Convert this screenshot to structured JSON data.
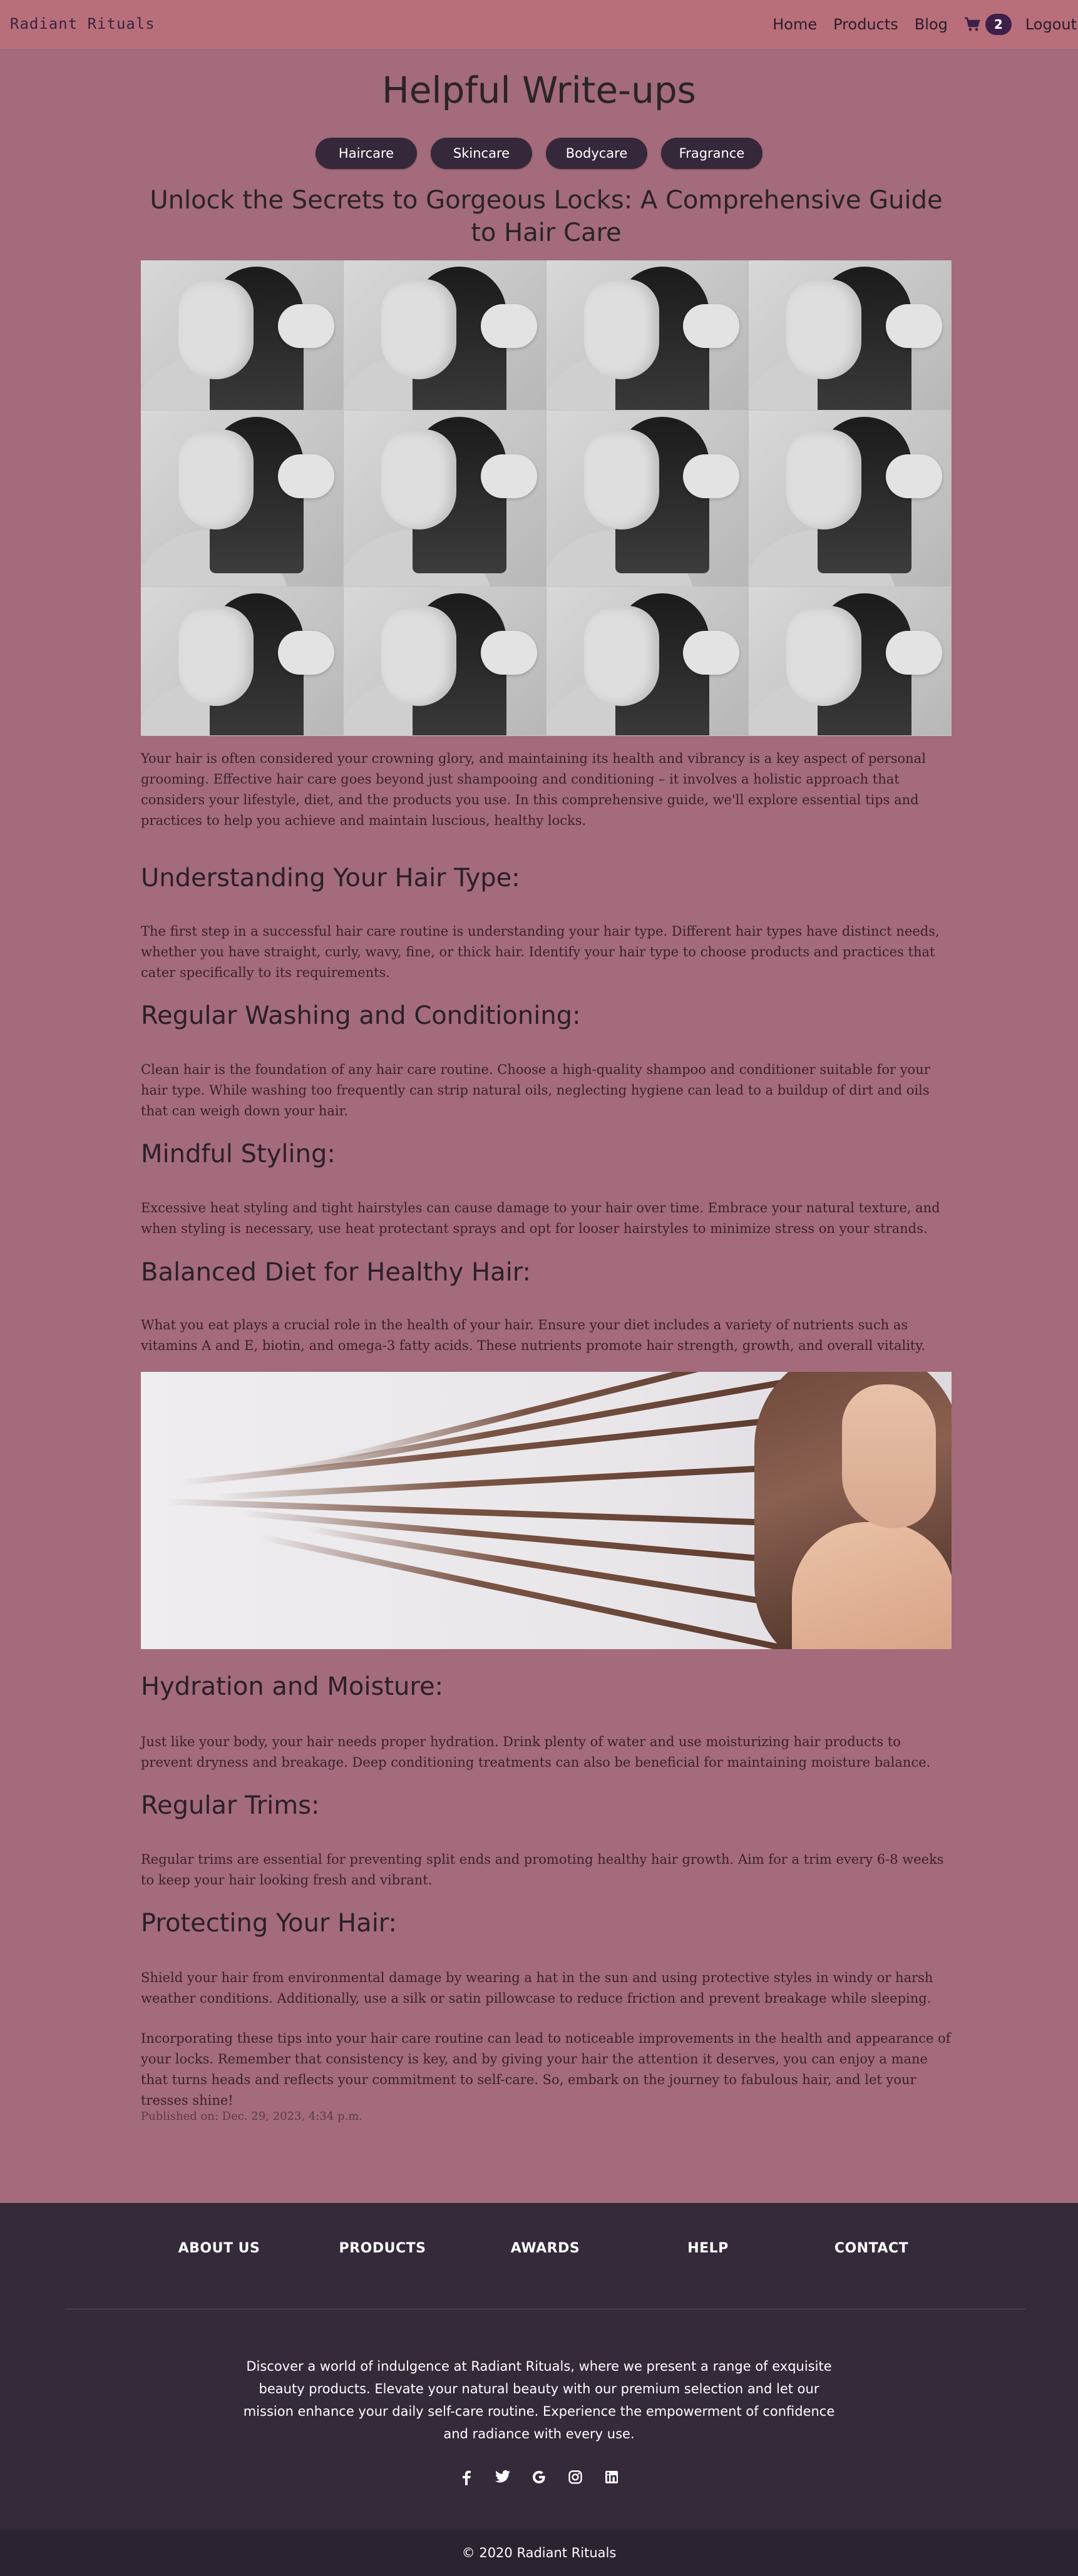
{
  "nav": {
    "brand": "Radiant Rituals",
    "links": [
      "Home",
      "Products",
      "Blog"
    ],
    "cart_count": "2",
    "logout": "Logout"
  },
  "page": {
    "title": "Helpful Write-ups",
    "categories": [
      "Haircare",
      "Skincare",
      "Bodycare",
      "Fragrance"
    ]
  },
  "article": {
    "title": "Unlock the Secrets to Gorgeous Locks: A Comprehensive Guide to Hair Care",
    "intro": "Your hair is often considered your crowning glory, and maintaining its health and vibrancy is a key aspect of personal grooming. Effective hair care goes beyond just shampooing and conditioning – it involves a holistic approach that considers your lifestyle, diet, and the products you use. In this comprehensive guide, we'll explore essential tips and practices to help you achieve and maintain luscious, healthy locks.",
    "sections": [
      {
        "heading": "Understanding Your Hair Type:",
        "body": "The first step in a successful hair care routine is understanding your hair type. Different hair types have distinct needs, whether you have straight, curly, wavy, fine, or thick hair. Identify your hair type to choose products and practices that cater specifically to its requirements."
      },
      {
        "heading": "Regular Washing and Conditioning:",
        "body": "Clean hair is the foundation of any hair care routine. Choose a high-quality shampoo and conditioner suitable for your hair type. While washing too frequently can strip natural oils, neglecting hygiene can lead to a buildup of dirt and oils that can weigh down your hair."
      },
      {
        "heading": "Mindful Styling:",
        "body": "Excessive heat styling and tight hairstyles can cause damage to your hair over time. Embrace your natural texture, and when styling is necessary, use heat protectant sprays and opt for looser hairstyles to minimize stress on your strands."
      },
      {
        "heading": "Balanced Diet for Healthy Hair:",
        "body": "What you eat plays a crucial role in the health of your hair. Ensure your diet includes a variety of nutrients such as vitamins A and E, biotin, and omega-3 fatty acids. These nutrients promote hair strength, growth, and overall vitality."
      },
      {
        "heading": "Hydration and Moisture:",
        "body": "Just like your body, your hair needs proper hydration. Drink plenty of water and use moisturizing hair products to prevent dryness and breakage. Deep conditioning treatments can also be beneficial for maintaining moisture balance."
      },
      {
        "heading": "Regular Trims:",
        "body": "Regular trims are essential for preventing split ends and promoting healthy hair growth. Aim for a trim every 6-8 weeks to keep your hair looking fresh and vibrant."
      },
      {
        "heading": "Protecting Your Hair:",
        "body": "Shield your hair from environmental damage by wearing a hat in the sun and using protective styles in windy or harsh weather conditions. Additionally, use a silk or satin pillowcase to reduce friction and prevent breakage while sleeping."
      }
    ],
    "conclusion": "Incorporating these tips into your hair care routine can lead to noticeable improvements in the health and appearance of your locks. Remember that consistency is key, and by giving your hair the attention it deserves, you can enjoy a mane that turns heads and reflects your commitment to self-care. So, embark on the journey to fabulous hair, and let your tresses shine!",
    "published": "Published on: Dec. 29, 2023, 4:34 p.m."
  },
  "footer": {
    "nav": [
      "ABOUT US",
      "PRODUCTS",
      "AWARDS",
      "HELP",
      "CONTACT"
    ],
    "description": "Discover a world of indulgence at Radiant Rituals, where we present a range of exquisite beauty products. Elevate your natural beauty with our premium selection and let our mission enhance your daily self-care routine. Experience the empowerment of confidence and radiance with every use.",
    "social_icons": [
      "facebook-icon",
      "twitter-icon",
      "google-icon",
      "instagram-icon",
      "linkedin-icon"
    ],
    "copyright": "© 2020 Radiant Rituals"
  },
  "colors": {
    "background": "#a36b7b",
    "navbar": "#b86f7a",
    "pill": "#35283a",
    "footer": "#342a3a",
    "badge": "#3e1f4a"
  }
}
